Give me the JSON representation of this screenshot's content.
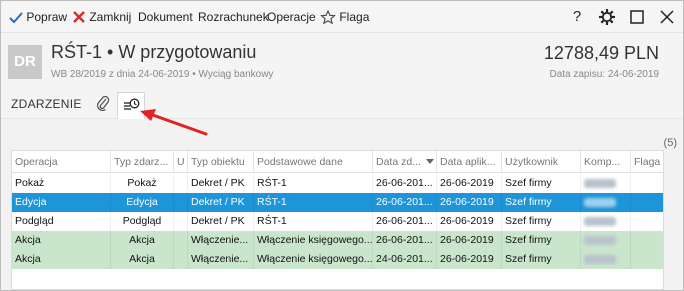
{
  "toolbar": {
    "items": [
      {
        "label": "Popraw",
        "icon": "check-icon"
      },
      {
        "label": "Zamknij",
        "icon": "close-icon"
      },
      {
        "label": "Dokument",
        "icon": ""
      },
      {
        "label": "Rozrachunek",
        "icon": ""
      },
      {
        "label": "Operacje",
        "icon": ""
      },
      {
        "label": "Flaga",
        "icon": "star-icon"
      }
    ],
    "window_controls": [
      "help-icon",
      "settings-icon",
      "maximize-icon",
      "close-window-icon"
    ],
    "help_glyph": "?"
  },
  "header": {
    "avatar_text": "DR",
    "title": "RŚT-1 • W przygotowaniu",
    "subtitle": "WB 28/2019 z dnia 24-06-2019 • Wyciąg bankowy",
    "amount": "12788,49 PLN",
    "date_saved": "Data zapisu: 24-06-2019"
  },
  "tabs": {
    "event_label": "ZDARZENIE",
    "attachment_icon": "paperclip-icon",
    "history_icon": "history-icon"
  },
  "grid": {
    "count": "(5)",
    "columns": [
      "Operacja",
      "Typ zdarz...",
      "U",
      "Typ obiektu",
      "Podstawowe dane",
      "Data zd...",
      "Data aplik...",
      "Użytkownik",
      "Komp...",
      "Flaga"
    ],
    "sort_column": "Data zd...",
    "rows": [
      {
        "operacja": "Pokaż",
        "typ_zdarzenia": "Pokaż",
        "u": "",
        "typ_obiektu": "Dekret / PK",
        "podstawowe_dane": "RŚT-1",
        "data_zd": "26-06-201...",
        "data_aplik": "26-06-2019",
        "uzytkownik": "Szef firmy",
        "state": "normal"
      },
      {
        "operacja": "Edycja",
        "typ_zdarzenia": "Edycja",
        "u": "",
        "typ_obiektu": "Dekret / PK",
        "podstawowe_dane": "RŚT-1",
        "data_zd": "26-06-201...",
        "data_aplik": "26-06-2019",
        "uzytkownik": "Szef firmy",
        "state": "selected"
      },
      {
        "operacja": "Podgląd",
        "typ_zdarzenia": "Podgląd",
        "u": "",
        "typ_obiektu": "Dekret / PK",
        "podstawowe_dane": "RŚT-1",
        "data_zd": "26-06-201...",
        "data_aplik": "26-06-2019",
        "uzytkownik": "Szef firmy",
        "state": "normal"
      },
      {
        "operacja": "Akcja",
        "typ_zdarzenia": "Akcja",
        "u": "",
        "typ_obiektu": "Włączenie...",
        "podstawowe_dane": "Włączenie księgowego...",
        "data_zd": "26-06-201...",
        "data_aplik": "26-06-2019",
        "uzytkownik": "Szef firmy",
        "state": "green"
      },
      {
        "operacja": "Akcja",
        "typ_zdarzenia": "Akcja",
        "u": "",
        "typ_obiektu": "Włączenie...",
        "podstawowe_dane": "Włączenie księgowego...",
        "data_zd": "24-06-201...",
        "data_aplik": "26-06-2019",
        "uzytkownik": "Szef firmy",
        "state": "green"
      }
    ]
  },
  "colors": {
    "selected_row": "#1e95d9",
    "green_row": "#c9e5cc",
    "close_icon": "#d92b2b",
    "annotation_arrow": "#e02424"
  }
}
